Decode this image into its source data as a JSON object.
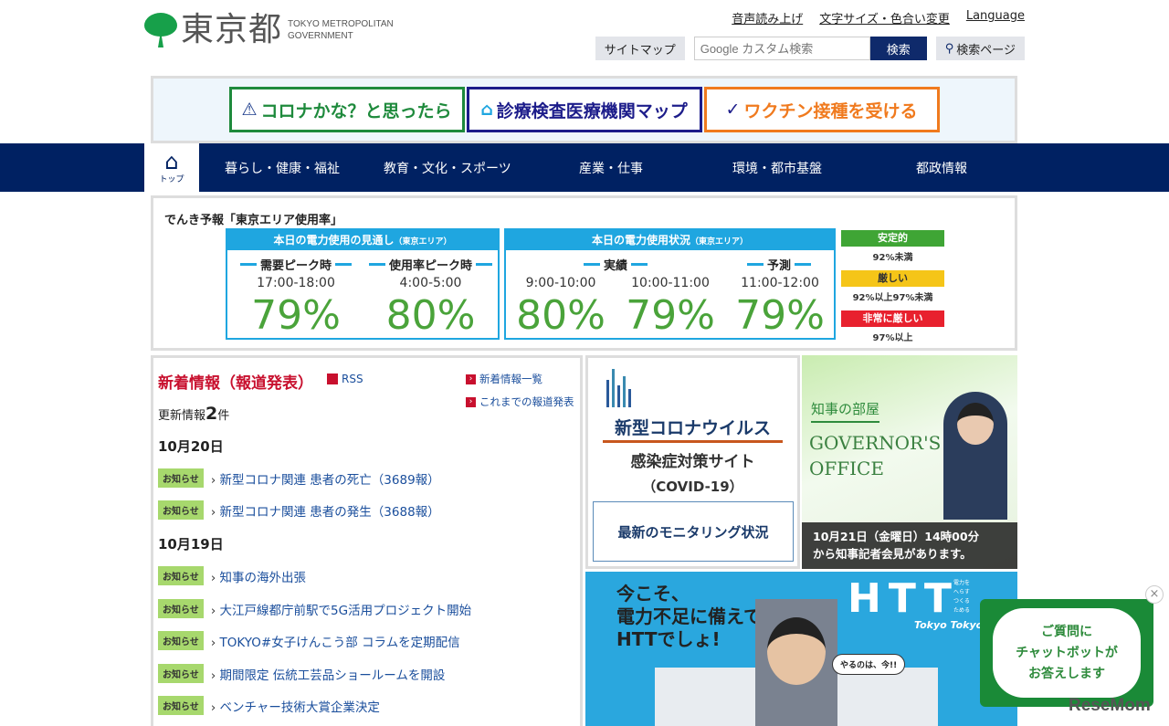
{
  "header": {
    "logo_jp": "東京都",
    "logo_en_1": "TOKYO METROPOLITAN",
    "logo_en_2": "GOVERNMENT",
    "links": [
      "音声読み上げ",
      "文字サイズ・色合い変更",
      "Language"
    ],
    "sitemap": "サイトマップ",
    "search_placeholder": "Google カスタム検索",
    "search_button": "検索",
    "search_page": "検索ページ"
  },
  "banners": [
    {
      "label": "コロナかな？と思ったら",
      "color": "#1e8a3c"
    },
    {
      "label": "診療検査医療機関マップ",
      "color": "#1c1c8a"
    },
    {
      "label": "ワクチン接種を受ける",
      "color": "#f07a1e"
    }
  ],
  "nav": {
    "home": "トップ",
    "items": [
      "暮らし・健康・福祉",
      "教育・文化・スポーツ",
      "産業・仕事",
      "環境・都市基盤",
      "都政情報"
    ]
  },
  "denki": {
    "title": "でんき予報「東京エリア使用率」",
    "forecast": {
      "header": "本日の電力使用の見通し",
      "area": "（東京エリア）",
      "cols": [
        {
          "label": "需要ピーク時",
          "time": "17:00-18:00",
          "pct": "79%"
        },
        {
          "label": "使用率ピーク時",
          "time": "4:00-5:00",
          "pct": "80%"
        }
      ]
    },
    "status": {
      "header": "本日の電力使用状況",
      "area": "（東京エリア）",
      "actual_label": "実績",
      "predict_label": "予測",
      "cols": [
        {
          "time": "9:00-10:00",
          "pct": "80%"
        },
        {
          "time": "10:00-11:00",
          "pct": "79%"
        },
        {
          "time": "11:00-12:00",
          "pct": "79%"
        }
      ]
    },
    "legend": [
      {
        "label": "安定的",
        "desc": "92%未満",
        "color": "#3fa535"
      },
      {
        "label": "厳しい",
        "desc": "92%以上97%未満",
        "color": "#f5c518"
      },
      {
        "label": "非常に厳しい",
        "desc": "97%以上",
        "color": "#e8212e"
      }
    ]
  },
  "news": {
    "title": "新着情報（報道発表）",
    "rss": "RSS",
    "link_list": "新着情報一覧",
    "link_past": "これまでの報道発表",
    "count_prefix": "更新情報",
    "count": "2",
    "count_suffix": "件",
    "badge": "お知らせ",
    "groups": [
      {
        "date": "10月20日",
        "items": [
          "新型コロナ関連 患者の死亡（3689報）",
          "新型コロナ関連 患者の発生（3688報）"
        ]
      },
      {
        "date": "10月19日",
        "items": [
          "知事の海外出張",
          "大江戸線都庁前駅で5G活用プロジェクト開始",
          "TOKYO#女子けんこう部 コラムを定期配信",
          "期間限定 伝統工芸品ショールームを開設",
          "ベンチャー技術大賞企業決定"
        ]
      }
    ]
  },
  "covid": {
    "line1": "新型コロナウイルス",
    "line2": "感染症対策サイト",
    "line3": "（COVID-19）",
    "button": "最新のモニタリング状況"
  },
  "governor": {
    "jp": "知事の部屋",
    "en1": "GOVERNOR'S",
    "en2": "OFFICE",
    "notice1": "10月21日（金曜日）14時00分",
    "notice2": "から知事記者会見があります。"
  },
  "htt": {
    "line1": "今こそ、",
    "line2": "電力不足に備えて、",
    "line3": "HTTでしょ!",
    "logo": "HTT",
    "sub": [
      "電力を",
      "へらす",
      "つくる",
      "ためる"
    ],
    "brand": "Tokyo Tokyo",
    "bubble": "やるのは、今!!"
  },
  "chat": {
    "line1": "ご質問に",
    "line2": "チャットボットが",
    "line3": "お答えします",
    "close": "×"
  },
  "watermark": "ReseMom"
}
